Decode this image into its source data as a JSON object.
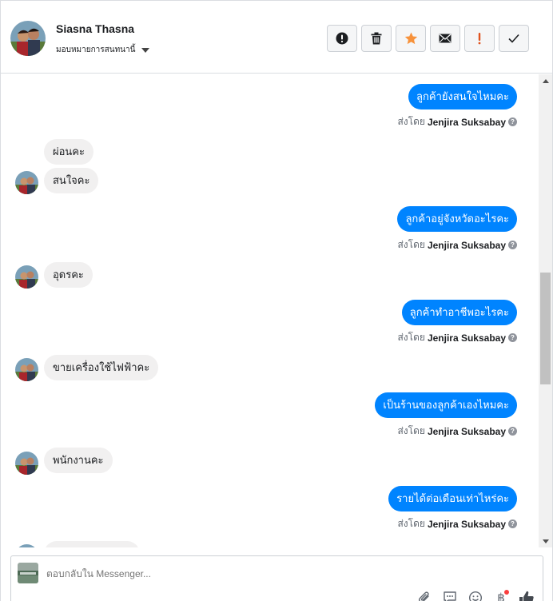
{
  "header": {
    "contact_name": "Siasna Thasna",
    "assign_label": "มอบหมายการสนทนานี้",
    "actions": [
      {
        "name": "mark-spam-button",
        "icon": "exclamation-circle-icon"
      },
      {
        "name": "delete-button",
        "icon": "trash-icon"
      },
      {
        "name": "star-button",
        "icon": "star-icon",
        "color": "#f7923b"
      },
      {
        "name": "mark-unread-button",
        "icon": "envelope-icon"
      },
      {
        "name": "follow-up-button",
        "icon": "exclamation-icon",
        "color": "#e0531e"
      },
      {
        "name": "mark-done-button",
        "icon": "check-icon"
      }
    ]
  },
  "conversation": {
    "sent_by_prefix": "ส่งโดย",
    "sender": "Jenjira Suksabay",
    "messages": [
      {
        "direction": "out",
        "text": "ลูกค้ายังสนใจไหมคะ"
      },
      {
        "direction": "in",
        "text": "ผ่อนคะ"
      },
      {
        "direction": "in",
        "text": "สนใจคะ"
      },
      {
        "direction": "out",
        "text": "ลูกค้าอยู่จังหวัดอะไรคะ"
      },
      {
        "direction": "in",
        "text": "อุดรคะ"
      },
      {
        "direction": "out",
        "text": "ลูกค้าทำอาชีพอะไรคะ"
      },
      {
        "direction": "in",
        "text": "ขายเครื่องใช้ไฟฟ้าคะ"
      },
      {
        "direction": "out",
        "text": "เป็นร้านของลูกค้าเองไหมคะ"
      },
      {
        "direction": "in",
        "text": "พนักงานคะ"
      },
      {
        "direction": "out",
        "text": "รายได้ต่อเดือนเท่าไหร่คะ"
      }
    ]
  },
  "composer": {
    "placeholder": "ตอบกลับใน Messenger...",
    "currency_symbol": "฿"
  },
  "colors": {
    "outgoing_bubble": "#0084ff",
    "incoming_bubble": "#f1f0f0",
    "star": "#f7923b",
    "follow_up": "#e0531e"
  }
}
